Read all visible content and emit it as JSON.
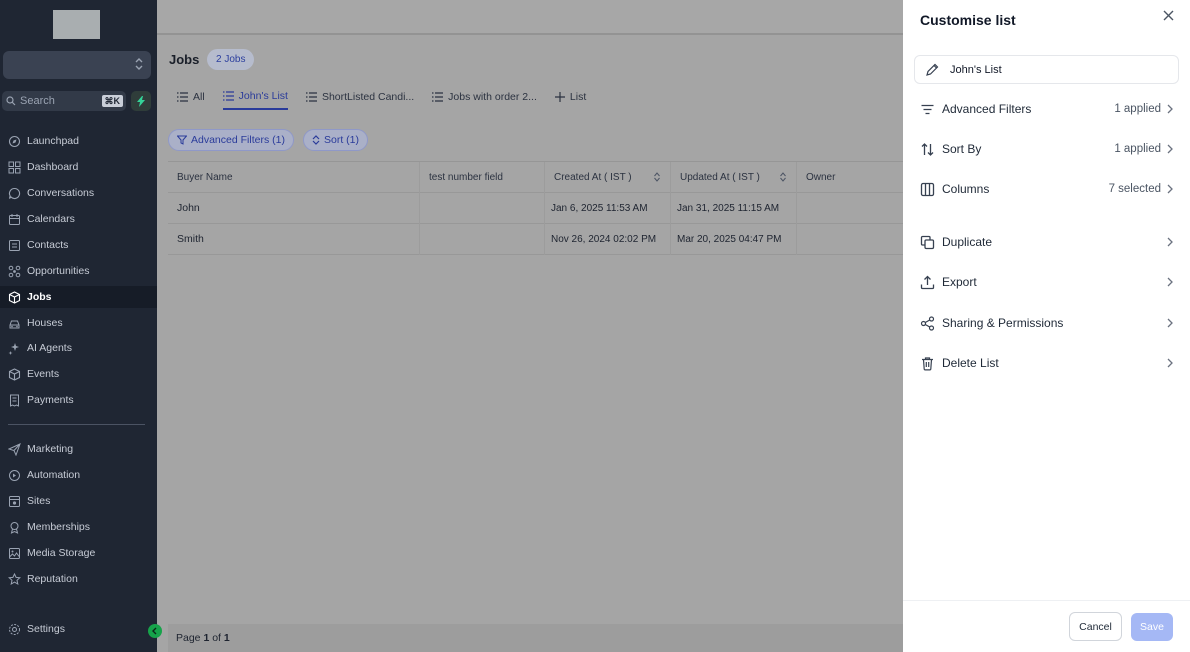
{
  "sidebar": {
    "search_placeholder": "Search",
    "search_shortcut": "⌘K",
    "items": [
      {
        "label": "Launchpad",
        "icon": "rocket-icon"
      },
      {
        "label": "Dashboard",
        "icon": "grid-icon"
      },
      {
        "label": "Conversations",
        "icon": "chat-icon"
      },
      {
        "label": "Calendars",
        "icon": "calendar-icon"
      },
      {
        "label": "Contacts",
        "icon": "contact-card-icon"
      },
      {
        "label": "Opportunities",
        "icon": "opportunities-icon"
      },
      {
        "label": "Jobs",
        "icon": "box-icon"
      },
      {
        "label": "Houses",
        "icon": "car-icon"
      },
      {
        "label": "AI Agents",
        "icon": "sparkle-icon"
      },
      {
        "label": "Events",
        "icon": "box-icon"
      },
      {
        "label": "Payments",
        "icon": "receipt-icon"
      },
      {
        "label": "Marketing",
        "icon": "send-icon"
      },
      {
        "label": "Automation",
        "icon": "automation-icon"
      },
      {
        "label": "Sites",
        "icon": "sites-icon"
      },
      {
        "label": "Memberships",
        "icon": "award-icon"
      },
      {
        "label": "Media Storage",
        "icon": "image-icon"
      },
      {
        "label": "Reputation",
        "icon": "star-icon"
      },
      {
        "label": "Settings",
        "icon": "gear-icon"
      }
    ],
    "active": "Jobs"
  },
  "main": {
    "title": "Jobs",
    "count_badge": "2 Jobs",
    "tabs": [
      {
        "label": "All"
      },
      {
        "label": "John's List"
      },
      {
        "label": "ShortListed Candi..."
      },
      {
        "label": "Jobs with order 2..."
      },
      {
        "label": "List"
      }
    ],
    "active_tab": "John's List",
    "filter_chip": "Advanced Filters (1)",
    "sort_chip": "Sort (1)",
    "columns": [
      "Buyer Name",
      "test number field",
      "Created At ( IST )",
      "Updated At ( IST )",
      "Owner"
    ],
    "rows": [
      {
        "buyer": "John",
        "number": "",
        "created": "Jan 6, 2025 11:53 AM",
        "updated": "Jan 31, 2025 11:15 AM",
        "owner": ""
      },
      {
        "buyer": "Smith",
        "number": "",
        "created": "Nov 26, 2024 02:02 PM",
        "updated": "Mar 20, 2025 04:47 PM",
        "owner": ""
      }
    ],
    "page_prefix": "Page",
    "page_current": "1",
    "page_of": "of",
    "page_total": "1"
  },
  "panel": {
    "title": "Customise list",
    "list_name": "John's List",
    "options": [
      {
        "label": "Advanced Filters",
        "value": "1 applied",
        "icon": "filter-lines-icon"
      },
      {
        "label": "Sort By",
        "value": "1 applied",
        "icon": "sort-arrows-icon"
      },
      {
        "label": "Columns",
        "value": "7 selected",
        "icon": "columns-icon"
      },
      {
        "label": "Duplicate",
        "value": "",
        "icon": "copy-icon"
      },
      {
        "label": "Export",
        "value": "",
        "icon": "upload-icon"
      },
      {
        "label": "Sharing & Permissions",
        "value": "",
        "icon": "share-icon"
      },
      {
        "label": "Delete List",
        "value": "",
        "icon": "trash-icon"
      }
    ],
    "cancel_label": "Cancel",
    "save_label": "Save"
  },
  "colors": {
    "sidebar_bg": "#1f2633",
    "accent": "#2a3b9a",
    "save_disabled": "#a5b8f5",
    "collapse_green": "#16a34a"
  }
}
